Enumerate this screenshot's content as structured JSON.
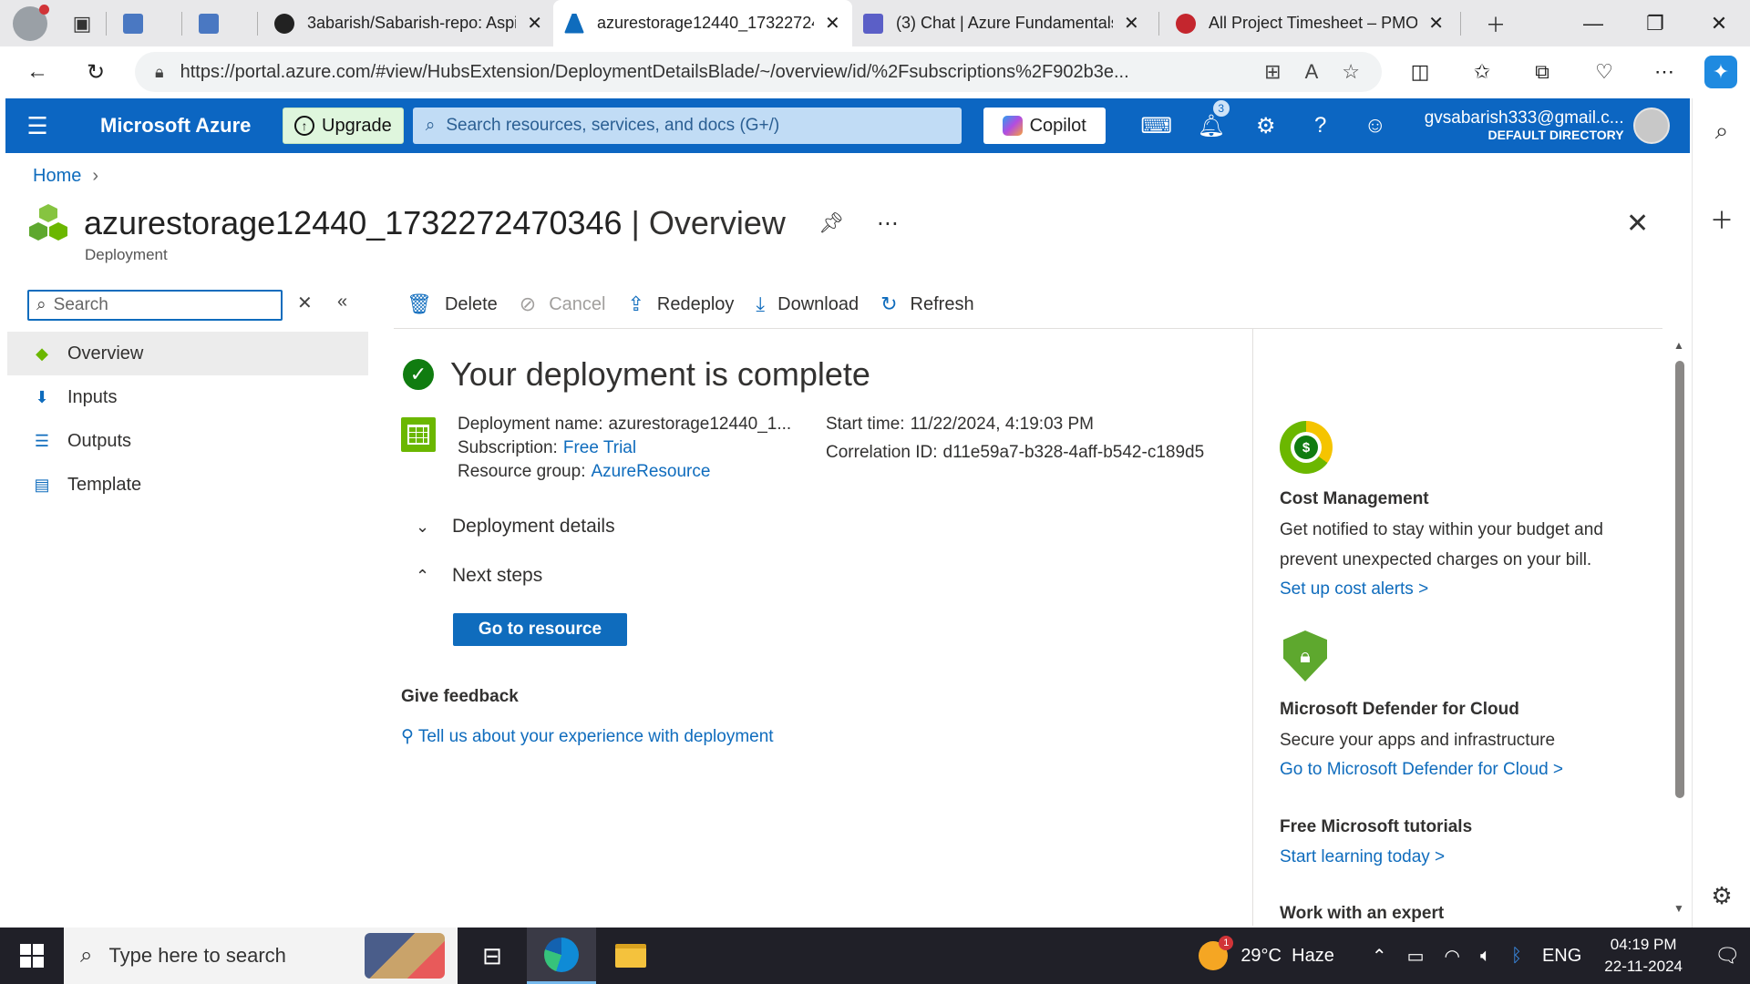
{
  "browser": {
    "tabs": [
      {
        "label": "",
        "icon": "file-icon",
        "color": "#4a78c2"
      },
      {
        "label": "",
        "icon": "outlook-icon",
        "color": "#4a78c2"
      },
      {
        "label": "3abarish/Sabarish-repo: Aspir",
        "icon": "github-icon",
        "color": "#222222"
      },
      {
        "label": "azurestorage12440_17322724",
        "icon": "azure-icon",
        "color": "#0f6cbd",
        "active": true
      },
      {
        "label": "(3) Chat | Azure Fundamentals",
        "icon": "teams-icon",
        "color": "#5b5fc7"
      },
      {
        "label": "All Project Timesheet – PMO",
        "icon": "pmo-icon",
        "color": "#c4262e"
      }
    ],
    "url": "https://portal.azure.com/#view/HubsExtension/DeploymentDetailsBlade/~/overview/id/%2Fsubscriptions%2F902b3e...",
    "extension_badge": "1"
  },
  "azure_header": {
    "brand": "Microsoft Azure",
    "upgrade_label": "Upgrade",
    "search_placeholder": "Search resources, services, and docs (G+/)",
    "copilot_label": "Copilot",
    "notifications_count": "3",
    "account_email": "gvsabarish333@gmail.c...",
    "account_directory": "DEFAULT DIRECTORY"
  },
  "breadcrumb": {
    "home": "Home"
  },
  "blade": {
    "title": "azurestorage12440_1732272470346",
    "title_suffix": " | Overview",
    "subtitle": "Deployment"
  },
  "left_nav": {
    "search_placeholder": "Search",
    "items": [
      {
        "label": "Overview",
        "icon": "overview-icon",
        "selected": true
      },
      {
        "label": "Inputs",
        "icon": "inputs-icon"
      },
      {
        "label": "Outputs",
        "icon": "outputs-icon"
      },
      {
        "label": "Template",
        "icon": "template-icon"
      }
    ]
  },
  "commands": [
    {
      "label": "Delete",
      "icon": "delete-icon",
      "enabled": true
    },
    {
      "label": "Cancel",
      "icon": "cancel-icon",
      "enabled": false
    },
    {
      "label": "Redeploy",
      "icon": "redeploy-icon",
      "enabled": true
    },
    {
      "label": "Download",
      "icon": "download-icon",
      "enabled": true
    },
    {
      "label": "Refresh",
      "icon": "refresh-icon",
      "enabled": true
    }
  ],
  "deployment": {
    "status": "Your deployment is complete",
    "name_label": "Deployment name:",
    "name_value": "azurestorage12440_1...",
    "subscription_label": "Subscription:",
    "subscription_value": "Free Trial",
    "rg_label": "Resource group:",
    "rg_value": "AzureResource",
    "start_label": "Start time:",
    "start_value": "11/22/2024, 4:19:03 PM",
    "corr_label": "Correlation ID:",
    "corr_value": "d11e59a7-b328-4aff-b542-c189d5",
    "details_label": "Deployment details",
    "next_label": "Next steps",
    "goto_label": "Go to resource",
    "feedback_heading": "Give feedback",
    "feedback_link": "Tell us about your experience with deployment"
  },
  "right_panel": {
    "cost_title": "Cost Management",
    "cost_desc1": "Get notified to stay within your budget and",
    "cost_desc2": "prevent unexpected charges on your bill.",
    "cost_link": "Set up cost alerts >",
    "defender_title": "Microsoft Defender for Cloud",
    "defender_desc": "Secure your apps and infrastructure",
    "defender_link": "Go to Microsoft Defender for Cloud >",
    "tutorials_title": "Free Microsoft tutorials",
    "tutorials_link": "Start learning today >",
    "expert_title": "Work with an expert"
  },
  "taskbar": {
    "search_placeholder": "Type here to search",
    "weather_temp": "29°C",
    "weather_desc": "Haze",
    "weather_badge": "1",
    "lang": "ENG",
    "time": "04:19 PM",
    "date": "22-11-2024"
  }
}
